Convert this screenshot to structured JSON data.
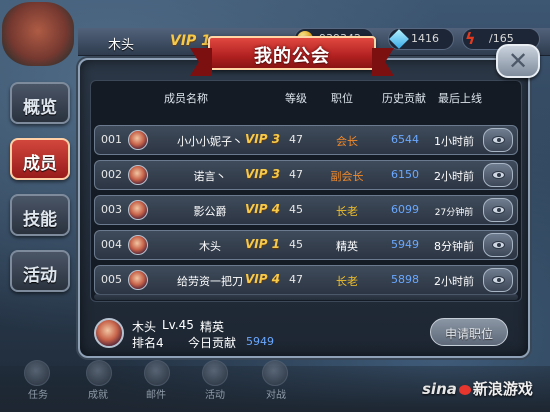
{
  "hud": {
    "player_name": "木头",
    "vip": "VIP 1",
    "gold": "939342",
    "gems": "1416",
    "energy": "/165"
  },
  "title": "我的公会",
  "close_label": "✕",
  "side_tabs": [
    {
      "label": "概览",
      "active": false
    },
    {
      "label": "成员",
      "active": true
    },
    {
      "label": "技能",
      "active": false
    },
    {
      "label": "活动",
      "active": false
    }
  ],
  "table": {
    "headers": {
      "name": "成员名称",
      "level": "等级",
      "position": "职位",
      "contribution": "历史贡献",
      "last_online": "最后上线"
    },
    "rows": [
      {
        "index": "001",
        "name": "小小小妮子丶",
        "vip": "VIP 3",
        "level": "47",
        "position": "会长",
        "position_color": "#f28a2a",
        "contribution": "6544",
        "last_online": "1小时前"
      },
      {
        "index": "002",
        "name": "诺言丶",
        "vip": "VIP 3",
        "level": "47",
        "position": "副会长",
        "position_color": "#f28a2a",
        "contribution": "6150",
        "last_online": "2小时前"
      },
      {
        "index": "003",
        "name": "影公爵",
        "vip": "VIP 4",
        "level": "45",
        "position": "长老",
        "position_color": "#f2c02a",
        "contribution": "6099",
        "last_online": "27分钟前"
      },
      {
        "index": "004",
        "name": "木头",
        "vip": "VIP 1",
        "level": "45",
        "position": "精英",
        "position_color": "#ffffff",
        "contribution": "5949",
        "last_online": "8分钟前"
      },
      {
        "index": "005",
        "name": "给劳资一把刀",
        "vip": "VIP 4",
        "level": "47",
        "position": "长老",
        "position_color": "#f2c02a",
        "contribution": "5898",
        "last_online": "2小时前"
      }
    ]
  },
  "footer": {
    "name": "木头",
    "level": "Lv.45",
    "position": "精英",
    "rank": "排名4",
    "today_label": "今日贡献",
    "today_value": "5949",
    "apply_button": "申请职位"
  },
  "bottom_nav": [
    "任务",
    "成就",
    "邮件",
    "活动",
    "对战"
  ],
  "watermark": {
    "brand": "sina",
    "text": "新浪游戏"
  },
  "colors": {
    "accent_red": "#b22121",
    "vip_gold": "#f6c94a",
    "contribution_blue": "#6aa8ff"
  },
  "icons": [
    "gold-coin-icon",
    "gem-icon",
    "energy-bolt-icon",
    "close-icon",
    "view-eye-icon",
    "avatar"
  ]
}
